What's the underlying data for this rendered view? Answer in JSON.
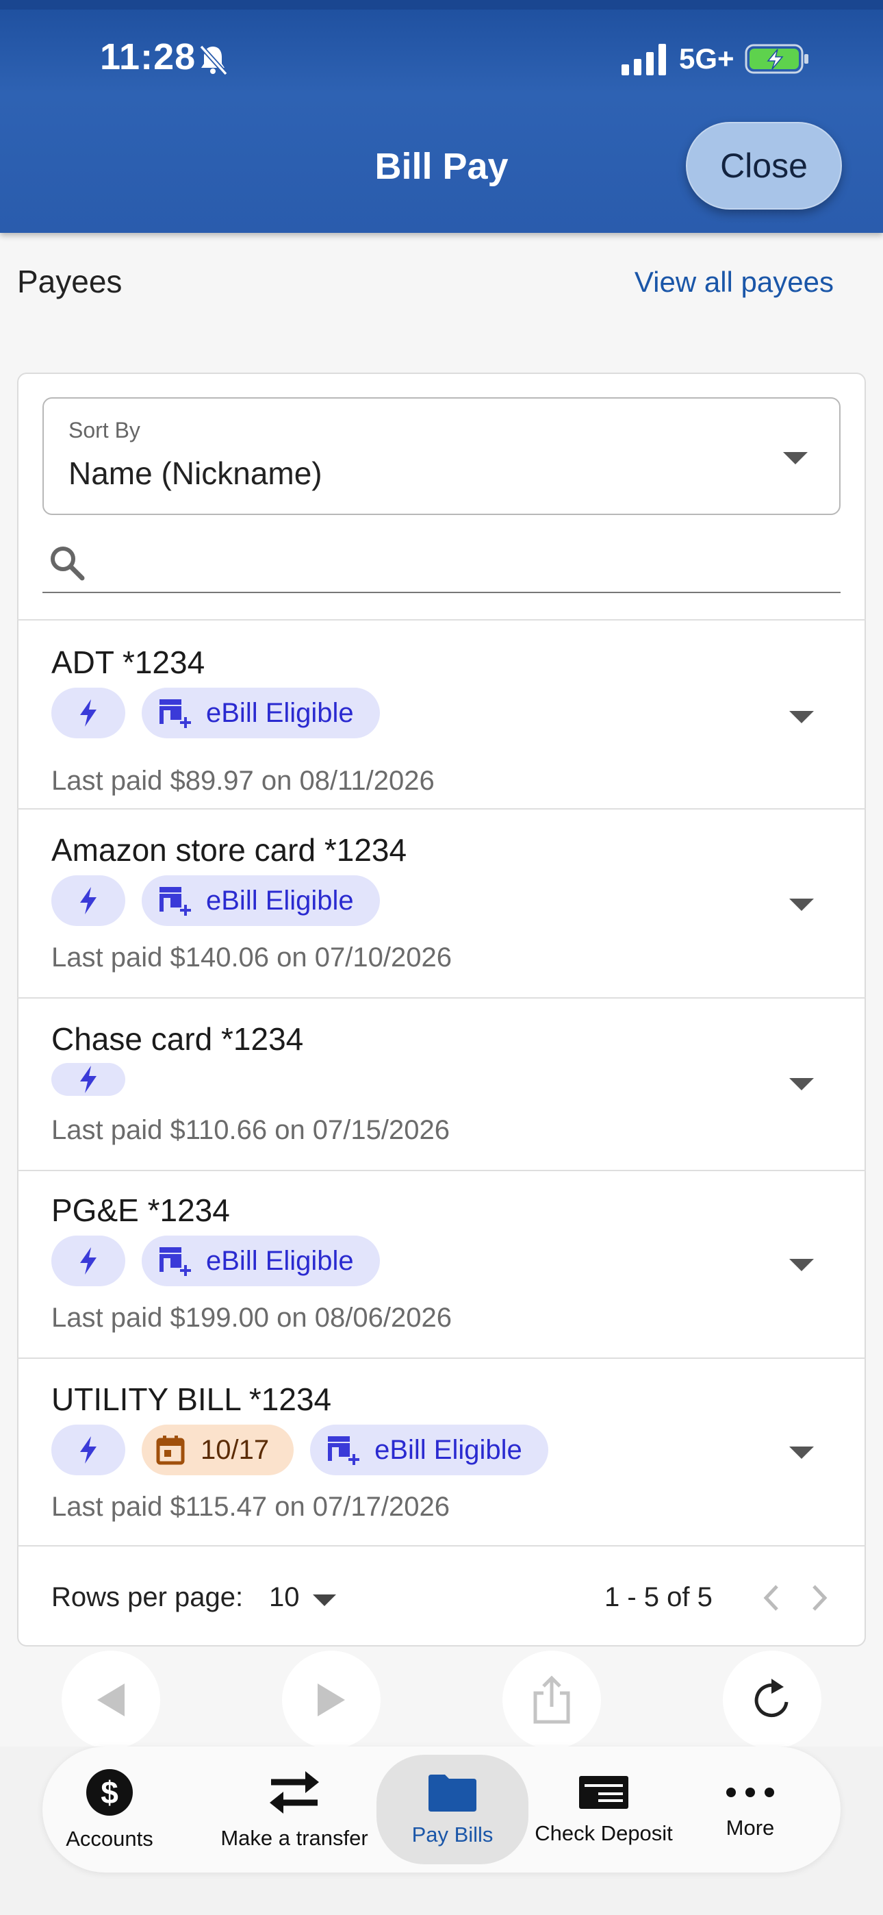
{
  "status_bar": {
    "time": "11:28",
    "network": "5G+"
  },
  "header": {
    "title": "Bill Pay",
    "close_label": "Close"
  },
  "payees_section": {
    "title": "Payees",
    "view_all_label": "View all payees"
  },
  "sort": {
    "label": "Sort By",
    "value": "Name (Nickname)"
  },
  "search": {
    "placeholder": ""
  },
  "payees": [
    {
      "name": "ADT *1234",
      "chips": [
        "bolt",
        "ebill"
      ],
      "last_paid": "Last paid $89.97 on 08/11/2026"
    },
    {
      "name": "Amazon store card *1234",
      "chips": [
        "bolt",
        "ebill"
      ],
      "last_paid": "Last paid $140.06 on 07/10/2026"
    },
    {
      "name": "Chase card *1234",
      "chips": [
        "bolt"
      ],
      "last_paid": "Last paid $110.66 on 07/15/2026"
    },
    {
      "name": "PG&E *1234",
      "chips": [
        "bolt",
        "ebill"
      ],
      "last_paid": "Last paid $199.00 on 08/06/2026"
    },
    {
      "name": "UTILITY BILL *1234",
      "chips": [
        "bolt",
        "date",
        "ebill"
      ],
      "due_date": "10/17",
      "last_paid": "Last paid $115.47 on 07/17/2026"
    }
  ],
  "chip_labels": {
    "ebill": "eBill Eligible"
  },
  "pagination": {
    "rows_label": "Rows per page:",
    "rows_value": "10",
    "range": "1 - 5 of 5"
  },
  "bottom_nav": [
    {
      "label": "Accounts",
      "icon": "dollar-icon"
    },
    {
      "label": "Make a transfer",
      "icon": "transfer-icon"
    },
    {
      "label": "Pay Bills",
      "icon": "folder-icon",
      "active": true
    },
    {
      "label": "Check Deposit",
      "icon": "check-icon"
    },
    {
      "label": "More",
      "icon": "more-icon"
    }
  ],
  "colors": {
    "header": "#2a5cad",
    "accent": "#1a56a8",
    "chip_bg": "#e2e4fb",
    "chip_text": "#2a2ad0",
    "date_chip_bg": "#fbe2cc"
  }
}
